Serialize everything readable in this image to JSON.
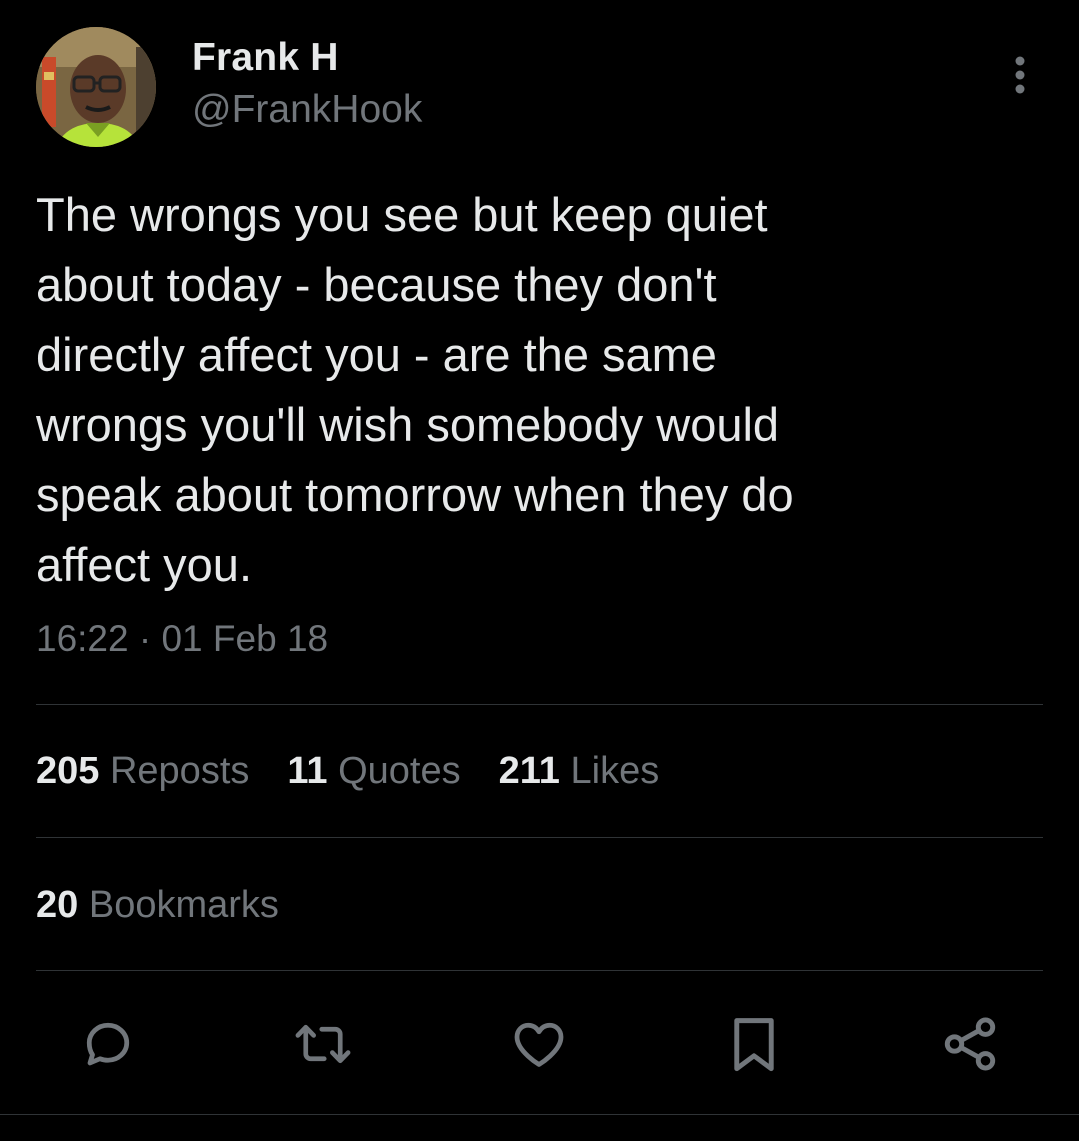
{
  "author": {
    "display_name": "Frank H",
    "handle": "@FrankHook",
    "avatar_icon": "profile-photo"
  },
  "tweet": {
    "text": "The wrongs you see but keep quiet\nabout today - because they don't\ndirectly affect you - are the same\nwrongs you'll wish somebody would\nspeak about tomorrow when they do\naffect you.",
    "timestamp": "16:22 · 01 Feb 18"
  },
  "stats": {
    "reposts": {
      "count": "205",
      "label": "Reposts"
    },
    "quotes": {
      "count": "11",
      "label": "Quotes"
    },
    "likes": {
      "count": "211",
      "label": "Likes"
    },
    "bookmarks": {
      "count": "20",
      "label": "Bookmarks"
    }
  },
  "actions": {
    "reply": "reply-icon",
    "repost": "repost-icon",
    "like": "heart-icon",
    "bookmark": "bookmark-icon",
    "share": "share-icon"
  },
  "colors": {
    "background": "#000000",
    "primary_text": "#e7e9ea",
    "secondary_text": "#71767b",
    "divider": "#2f3336"
  }
}
